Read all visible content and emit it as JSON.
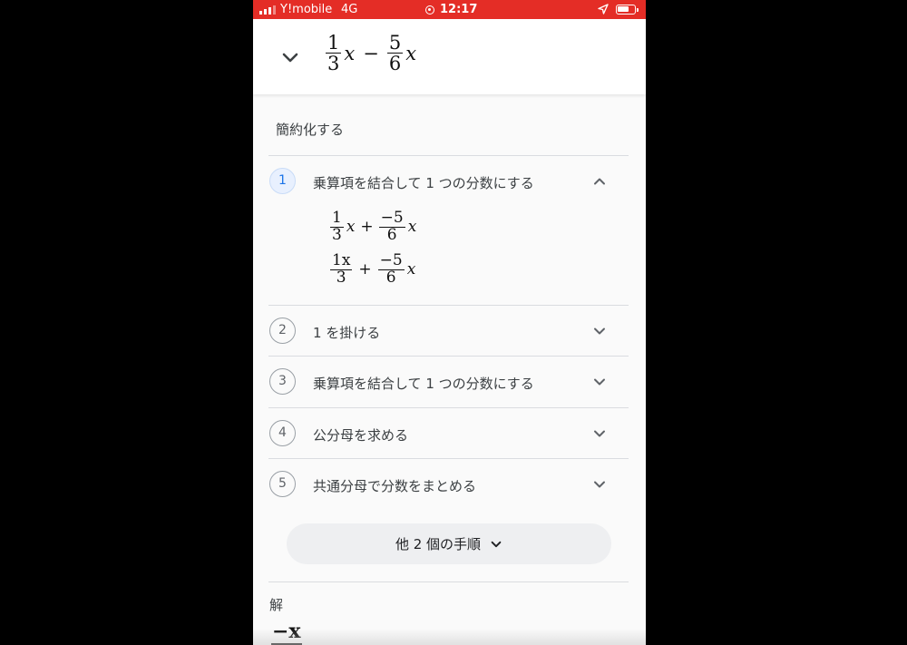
{
  "status_bar": {
    "carrier": "Y!mobile",
    "network": "4G",
    "time": "12:17"
  },
  "header": {
    "expression": {
      "term1": {
        "num": "1",
        "den": "3",
        "var": "x"
      },
      "operator": "−",
      "term2": {
        "num": "5",
        "den": "6",
        "var": "x"
      }
    }
  },
  "section_title": "簡約化する",
  "steps": [
    {
      "number": "1",
      "label": "乗算項を結合して 1 つの分数にする",
      "expanded": true
    },
    {
      "number": "2",
      "label": "1 を掛ける",
      "expanded": false
    },
    {
      "number": "3",
      "label": "乗算項を結合して 1 つの分数にする",
      "expanded": false
    },
    {
      "number": "4",
      "label": "公分母を求める",
      "expanded": false
    },
    {
      "number": "5",
      "label": "共通分母で分数をまとめる",
      "expanded": false
    }
  ],
  "step1_detail": {
    "line1": {
      "frac1": {
        "num": "1",
        "den": "3"
      },
      "var1": "x",
      "op": "+",
      "frac2": {
        "num": "−5",
        "den": "6"
      },
      "var2": "x"
    },
    "line2": {
      "frac1": {
        "num": "1x",
        "den": "3"
      },
      "op": "+",
      "frac2": {
        "num": "−5",
        "den": "6"
      },
      "var2": "x"
    }
  },
  "more_button_label": "他 2 個の手順",
  "answer_label": "解",
  "answer_partial": "−x",
  "colors": {
    "status_bar": "#e42d26",
    "active_step_bg": "#e8f0fe",
    "active_step_text": "#1a73e8"
  },
  "icons": [
    "signal-icon",
    "alarm-icon",
    "location-arrow-icon",
    "battery-icon",
    "chevron-down-icon",
    "chevron-up-icon"
  ]
}
